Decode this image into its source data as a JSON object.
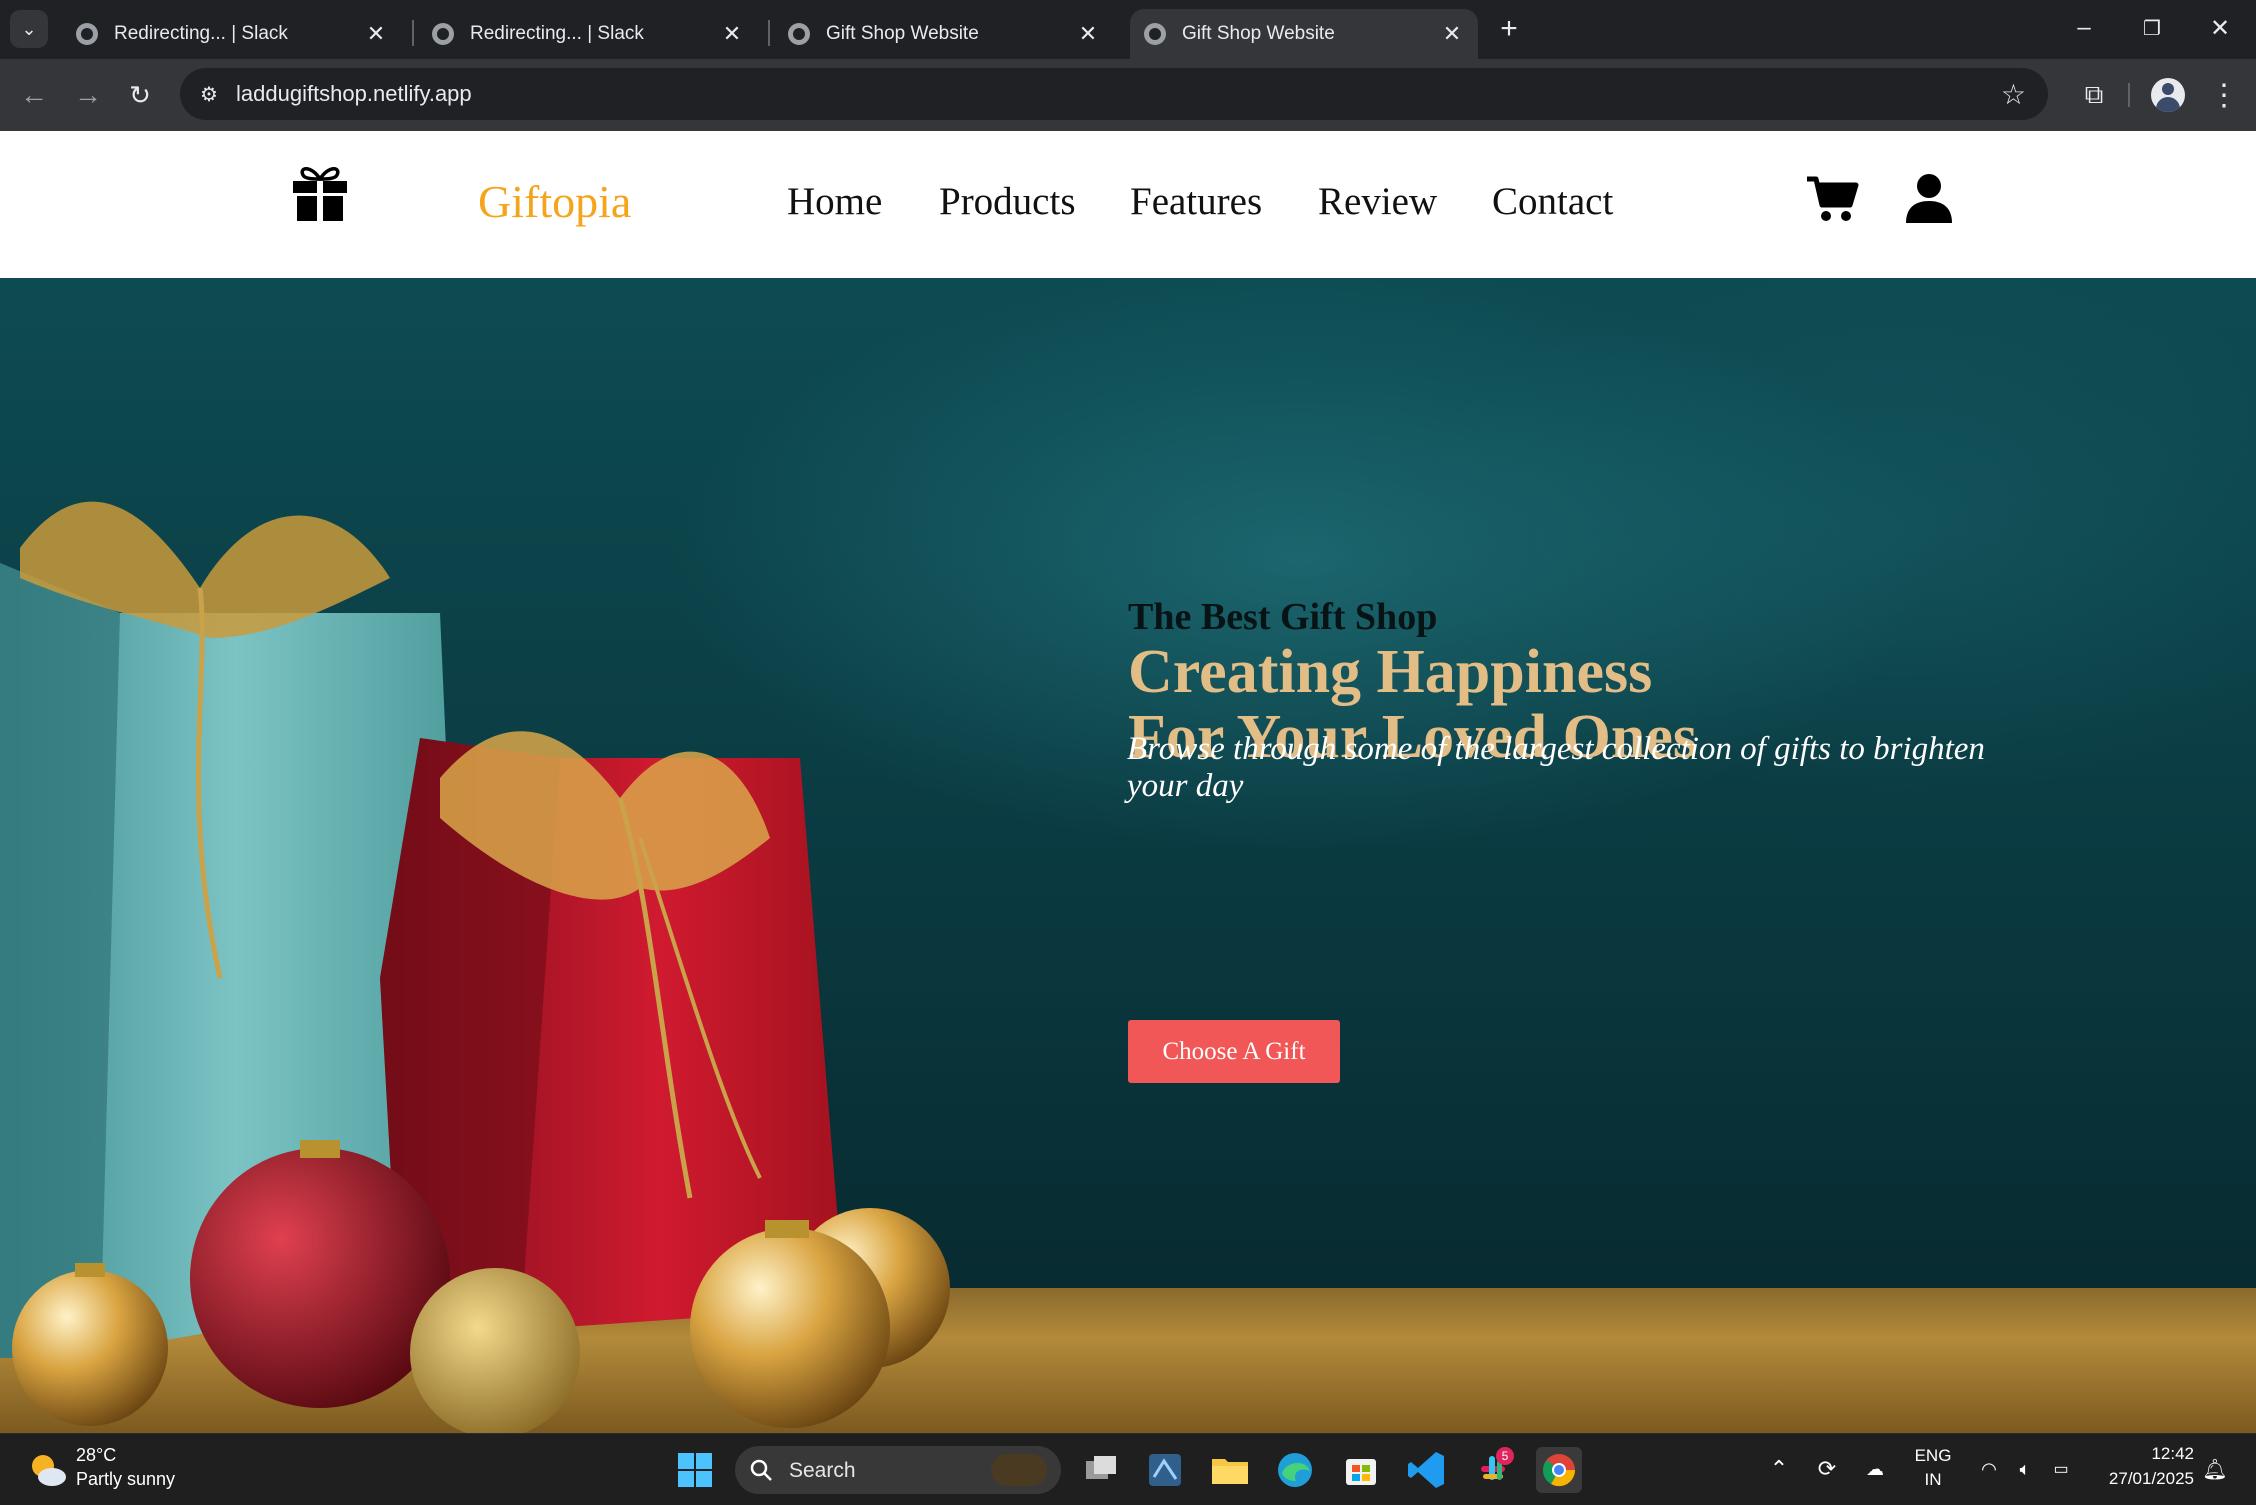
{
  "browser": {
    "tabs": [
      {
        "title": "Redirecting... | Slack",
        "active": false
      },
      {
        "title": "Redirecting... | Slack",
        "active": false
      },
      {
        "title": "Gift Shop Website",
        "active": false
      },
      {
        "title": "Gift Shop Website",
        "active": true
      }
    ],
    "url": "laddugiftshop.netlify.app"
  },
  "site": {
    "brand": "Giftopia",
    "nav": [
      "Home",
      "Products",
      "Features",
      "Review",
      "Contact"
    ],
    "hero": {
      "subtitle": "The Best Gift Shop",
      "headline_line1": "Creating Happiness",
      "headline_line2": "For Your Loved Ones",
      "description": "Browse through some of the largest collection of gifts to brighten your day",
      "cta": "Choose A Gift"
    },
    "colors": {
      "brand": "#f4a51c",
      "cta": "#f25757",
      "headline": "#e2bd85",
      "hero_bg": "#0d4b52"
    }
  },
  "taskbar": {
    "weather": {
      "temp": "28°C",
      "condition": "Partly sunny"
    },
    "search_placeholder": "Search",
    "slack_badge": "5",
    "language": {
      "line1": "ENG",
      "line2": "IN"
    },
    "clock": {
      "time": "12:42",
      "date": "27/01/2025"
    }
  }
}
